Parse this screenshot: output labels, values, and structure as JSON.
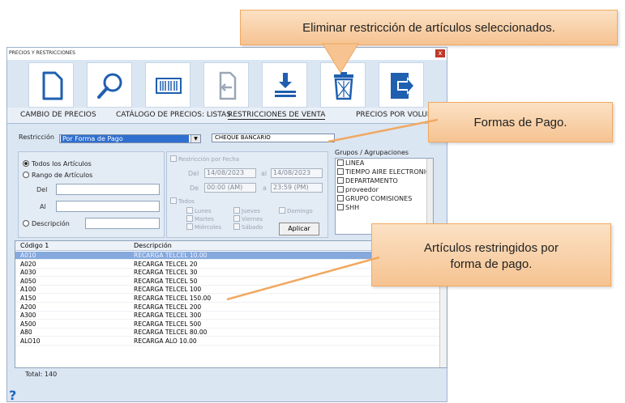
{
  "window": {
    "title": "PRECIOS Y RESTRICCIONES",
    "close": "x"
  },
  "toolbar": {
    "buttons": [
      {
        "icon": "new-document-icon"
      },
      {
        "icon": "search-icon"
      },
      {
        "icon": "barcode-icon"
      },
      {
        "icon": "import-icon"
      },
      {
        "icon": "download-icon"
      },
      {
        "icon": "trash-icon"
      },
      {
        "icon": "exit-icon"
      }
    ]
  },
  "tabs": [
    "CAMBIO DE PRECIOS",
    "CATÁLOGO DE PRECIOS: LISTAS",
    "RESTRICCIONES DE VENTA",
    "PRECIOS POR VOLUME"
  ],
  "filters": {
    "restriccion_label": "Restricción",
    "restriccion_value": "Por Forma de Pago",
    "forma_pago_value": "CHEQUE BANCARIO",
    "todos": "Todos los Artículos",
    "rango": "Rango de Artículos",
    "del": "Del",
    "al": "Al",
    "descripcion": "Descripción"
  },
  "date_panel": {
    "restrict_label": "Restricción por Fecha",
    "del": "Del",
    "al": "al",
    "date_from": "14/08/2023",
    "date_to": "14/08/2023",
    "de": "De",
    "a": "a",
    "time_from": "00:00 (AM)",
    "time_to": "23:59 (PM)",
    "todos": "Todos",
    "days": [
      "Lunes",
      "Jueves",
      "Domingo",
      "Martes",
      "Viernes",
      "Miércoles",
      "Sábado"
    ],
    "aplicar": "Aplicar"
  },
  "groups": {
    "title": "Grupos / Agrupaciones",
    "items": [
      "LINEA",
      "TIEMPO AIRE ELECTRONIC",
      "DEPARTAMENTO",
      "proveedor",
      "GRUPO COMISIONES",
      "SHH"
    ]
  },
  "grid": {
    "col1": "Código 1",
    "col2": "Descripción",
    "rows": [
      {
        "code": "A010",
        "desc": "RECARGA TELCEL 10.00"
      },
      {
        "code": "A020",
        "desc": "RECARGA TELCEL 20"
      },
      {
        "code": "A030",
        "desc": "RECARGA TELCEL 30"
      },
      {
        "code": "A050",
        "desc": "RECARGA TELCEL 50"
      },
      {
        "code": "A100",
        "desc": "RECARGA TELCEL 100"
      },
      {
        "code": "A150",
        "desc": "RECARGA TELCEL 150.00"
      },
      {
        "code": "A200",
        "desc": "RECARGA TELCEL 200"
      },
      {
        "code": "A300",
        "desc": "RECARGA TELCEL 300"
      },
      {
        "code": "A500",
        "desc": "RECARGA TELCEL 500"
      },
      {
        "code": "A80",
        "desc": "RECARGA TELCEL 80.00"
      },
      {
        "code": "ALO10",
        "desc": "RECARGA ALO 10.00"
      }
    ],
    "total": "Total: 140"
  },
  "help": "?",
  "callouts": {
    "eliminar": "Eliminar restricción de artículos seleccionados.",
    "formas": "Formas de Pago.",
    "articulos": "Artículos restringidos por forma de pago."
  },
  "colors": {
    "callout_fill": "#f6c391",
    "selection": "#86a9dd",
    "accent": "#1f66c2"
  }
}
